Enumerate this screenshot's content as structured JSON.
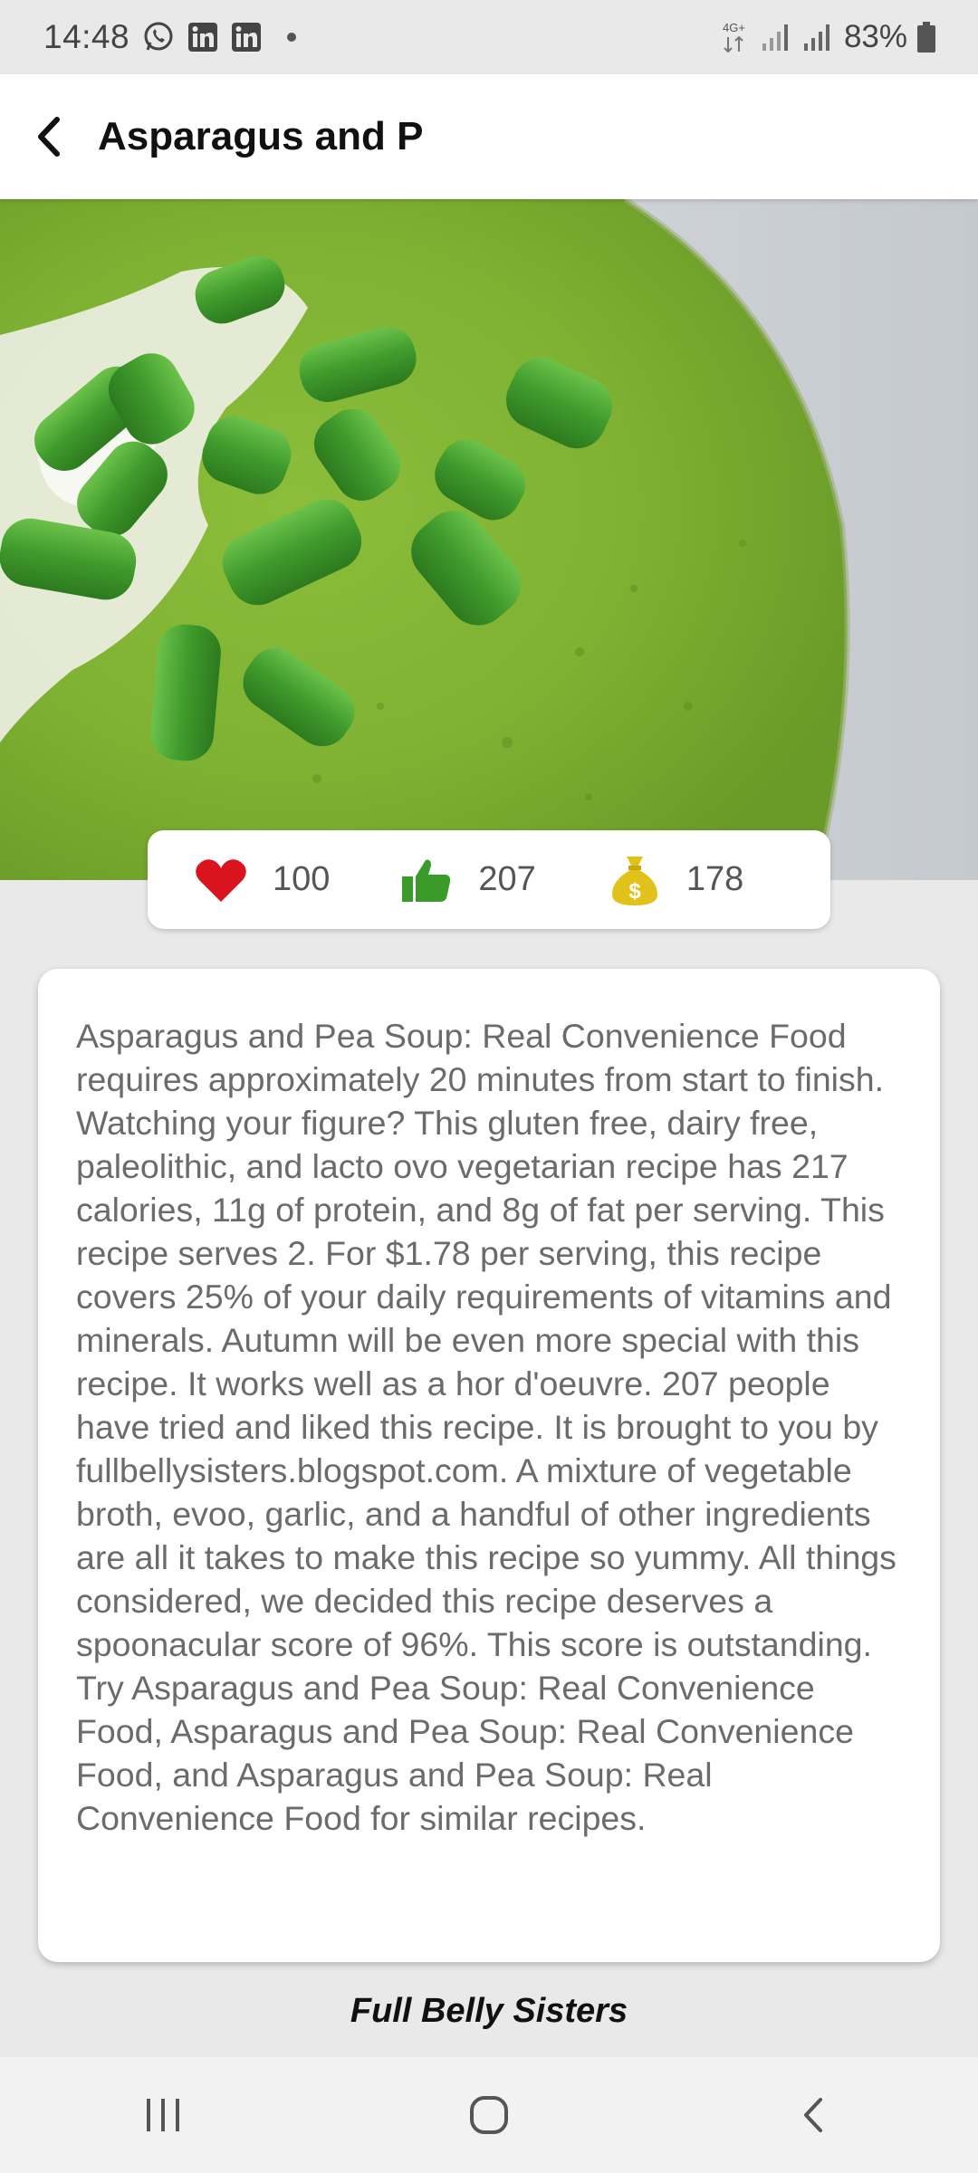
{
  "status_bar": {
    "time": "14:48",
    "battery": "83%",
    "network": "4G+",
    "icons": [
      "whatsapp-icon",
      "linkedin-icon",
      "linkedin-icon",
      "notification-dot-icon",
      "signal-icon",
      "battery-icon"
    ]
  },
  "app_bar": {
    "title": "Asparagus and P"
  },
  "stats": {
    "favorites": "100",
    "likes": "207",
    "price": "178",
    "heart_color": "#d9141e",
    "thumb_color": "#3a9a2a",
    "money_color": "#e0c21a"
  },
  "description": "Asparagus and Pea Soup: Real Convenience Food requires approximately 20 minutes from start to finish. Watching your figure? This gluten free, dairy free, paleolithic, and lacto ovo vegetarian recipe has 217 calories, 11g of protein, and 8g of fat per serving. This recipe serves 2. For $1.78 per serving, this recipe covers 25% of your daily requirements of vitamins and minerals. Autumn will be even more special with this recipe. It works well as a hor d'oeuvre. 207 people have tried and liked this recipe. It is brought to you by fullbellysisters.blogspot.com. A mixture of vegetable broth, evoo, garlic, and a handful of other ingredients are all it takes to make this recipe so yummy. All things considered, we decided this recipe deserves a spoonacular score of 96%. This score is outstanding. Try Asparagus and Pea Soup: Real Convenience Food, Asparagus and Pea Soup: Real Convenience Food, and Asparagus and Pea Soup: Real Convenience Food for similar recipes.",
  "source": "Full Belly Sisters"
}
